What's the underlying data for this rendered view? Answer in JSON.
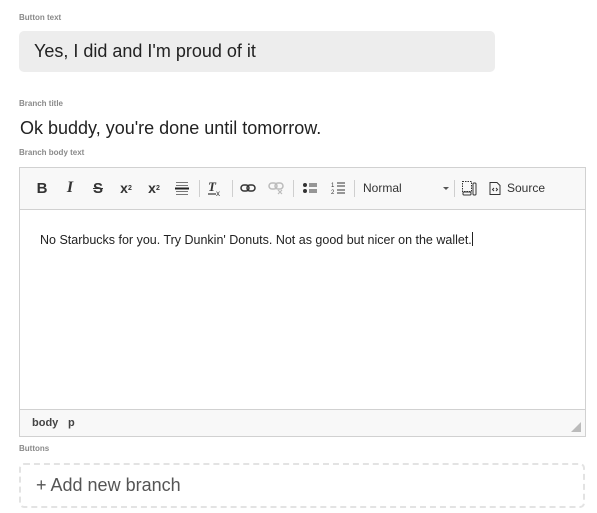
{
  "form": {
    "button_text_label": "Button text",
    "button_text_value": "Yes, I did and I'm proud of it",
    "branch_title_label": "Branch title",
    "branch_title_value": "Ok buddy, you're done until tomorrow.",
    "branch_body_label": "Branch body text",
    "buttons_label": "Buttons",
    "add_branch_label": "+ Add new branch"
  },
  "editor": {
    "toolbar": {
      "bold": "B",
      "italic": "I",
      "strike": "S",
      "superscript": "x",
      "superscript_mark": "2",
      "subscript": "x",
      "subscript_mark": "2",
      "format_select": "Normal",
      "source_label": "Source"
    },
    "content": "No Starbucks for you. Try Dunkin' Donuts. Not as good but nicer on the wallet.",
    "path": [
      "body",
      "p"
    ]
  }
}
